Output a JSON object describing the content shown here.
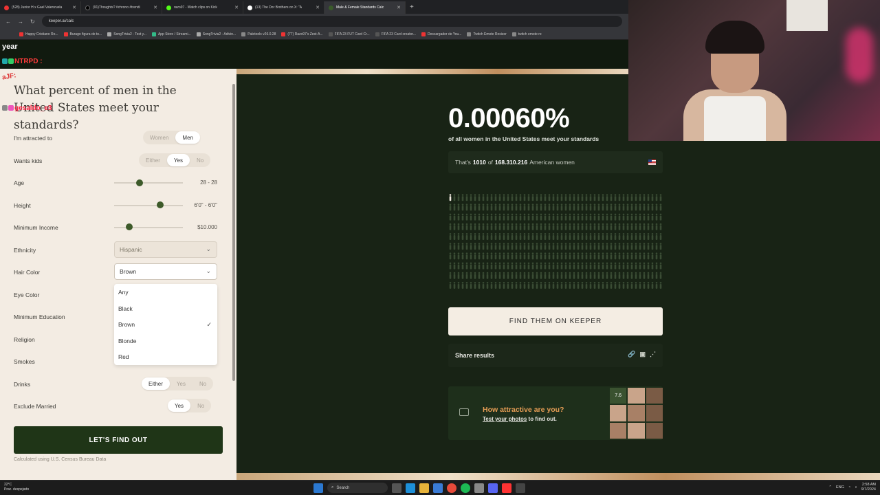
{
  "browser": {
    "tabs": [
      {
        "title": "(528) Junior H x Gael Valenzuela",
        "color": "#e33"
      },
      {
        "title": "(91)Thoughts? #chrono #trendi",
        "color": "#000"
      },
      {
        "title": "razo97 - Watch clips on Kick",
        "color": "#53fc18"
      },
      {
        "title": "(13) The Dor Brothers on X: \"A",
        "color": "#fff"
      },
      {
        "title": "Male & Female Standards Calc",
        "color": "#3a5a2a"
      }
    ],
    "url": "keeper.ai/calc",
    "bookmarks": [
      {
        "label": "Happy Cristiano Ro...",
        "color": "#e33"
      },
      {
        "label": "Burago figura de to...",
        "color": "#e33"
      },
      {
        "label": "SongTrivia2 - Test y...",
        "color": "#aaa"
      },
      {
        "label": "App Store / Streami...",
        "color": "#3b8"
      },
      {
        "label": "SongTrivia2 - Adivin...",
        "color": "#aaa"
      },
      {
        "label": "Paletools v26.0.28",
        "color": "#888"
      },
      {
        "label": "(77) Razo97's Zest-A...",
        "color": "#e33"
      },
      {
        "label": "FIFA 23 FUT Card Cr...",
        "color": "#555"
      },
      {
        "label": "FIFA 23 Card creator...",
        "color": "#555"
      },
      {
        "label": "Descargador de You...",
        "color": "#e33"
      },
      {
        "label": "Twitch Emote Resizer",
        "color": "#888"
      },
      {
        "label": "twitch emote re",
        "color": "#888"
      }
    ]
  },
  "chat": {
    "lines": [
      "year",
      "NTRPD :",
      "aJF:",
      "gesaldo_e3"
    ]
  },
  "form": {
    "question": "What percent of men in the United States meet your standards?",
    "attracted": {
      "label": "I'm attracted to",
      "options": [
        "Women",
        "Men"
      ],
      "selected": "Men"
    },
    "kids": {
      "label": "Wants kids",
      "options": [
        "Either",
        "Yes",
        "No"
      ],
      "selected": "Yes"
    },
    "age": {
      "label": "Age",
      "value": "28 - 28",
      "level": 0.2
    },
    "height": {
      "label": "Height",
      "value": "6'0\" - 6'0\"",
      "level": 0.5
    },
    "income": {
      "label": "Minimum Income",
      "value": "$10.000",
      "level": 0.05
    },
    "ethnicity": {
      "label": "Ethnicity",
      "value": "Hispanic"
    },
    "hair": {
      "label": "Hair Color",
      "value": "Brown",
      "options": [
        "Any",
        "Black",
        "Brown",
        "Blonde",
        "Red"
      ]
    },
    "eye": {
      "label": "Eye Color"
    },
    "education": {
      "label": "Minimum Education"
    },
    "religion": {
      "label": "Religion"
    },
    "smokes": {
      "label": "Smokes"
    },
    "drinks": {
      "label": "Drinks",
      "options": [
        "Either",
        "Yes",
        "No"
      ],
      "selected": "Either"
    },
    "married": {
      "label": "Exclude Married",
      "options": [
        "Yes",
        "No"
      ],
      "selected": "Yes"
    },
    "submit": "LET'S FIND OUT",
    "note": "Calculated using U.S. Census Bureau Data"
  },
  "result": {
    "percent": "0.00060%",
    "subtitle": "of all women in the United States meet your standards",
    "thats_prefix": "That's",
    "count": "1010",
    "of": "of",
    "total": "168.310.216",
    "suffix": "American women",
    "keeper_button": "FIND THEM ON KEEPER",
    "share_label": "Share results",
    "attractive_title": "How attractive are you?",
    "attractive_link": "Test your photos",
    "attractive_rest": "to find out.",
    "score": "7.6"
  },
  "taskbar": {
    "weather_temp": "22°C",
    "weather_desc": "Prac. despejado",
    "search": "Search",
    "lang": "ENG",
    "time": "2:58 AM",
    "date": "9/7/2024"
  },
  "colors": {
    "dark_bg": "#182315",
    "accent_green": "#1f3517",
    "orange": "#e69d55",
    "panel_bg": "#f3ece3"
  }
}
